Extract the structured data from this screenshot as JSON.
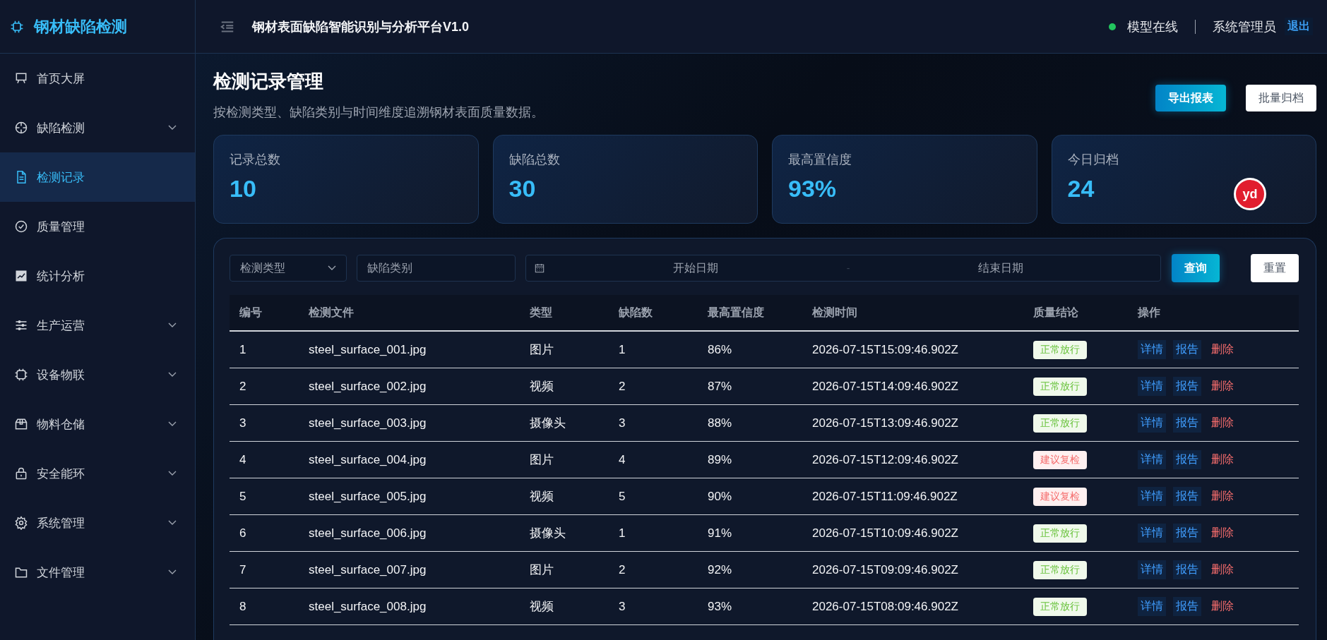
{
  "brand": {
    "name": "钢材缺陷检测"
  },
  "sidebar": {
    "items": [
      {
        "label": "首页大屏",
        "expandable": false,
        "selected": false
      },
      {
        "label": "缺陷检测",
        "expandable": true,
        "selected": false
      },
      {
        "label": "检测记录",
        "expandable": false,
        "selected": true
      },
      {
        "label": "质量管理",
        "expandable": false,
        "selected": false
      },
      {
        "label": "统计分析",
        "expandable": false,
        "selected": false
      },
      {
        "label": "生产运营",
        "expandable": true,
        "selected": false
      },
      {
        "label": "设备物联",
        "expandable": true,
        "selected": false
      },
      {
        "label": "物料仓储",
        "expandable": true,
        "selected": false
      },
      {
        "label": "安全能环",
        "expandable": true,
        "selected": false
      },
      {
        "label": "系统管理",
        "expandable": true,
        "selected": false
      },
      {
        "label": "文件管理",
        "expandable": true,
        "selected": false
      }
    ]
  },
  "header": {
    "title": "钢材表面缺陷智能识别与分析平台V1.0",
    "status": "模型在线",
    "user": "系统管理员",
    "logout": "退出"
  },
  "page": {
    "title": "检测记录管理",
    "subtitle": "按检测类型、缺陷类别与时间维度追溯钢材表面质量数据。",
    "actions": [
      {
        "label": "导出报表",
        "kind": "primary"
      },
      {
        "label": "批量归档",
        "kind": "plain"
      }
    ]
  },
  "stats": [
    {
      "label": "记录总数",
      "value": "10"
    },
    {
      "label": "缺陷总数",
      "value": "30"
    },
    {
      "label": "最高置信度",
      "value": "93%"
    },
    {
      "label": "今日归档",
      "value": "24",
      "badge": "yd"
    }
  ],
  "filters": {
    "type": {
      "placeholder": "检测类型"
    },
    "category": {
      "placeholder": "缺陷类别"
    },
    "start": {
      "placeholder": "开始日期"
    },
    "separator": "-",
    "end": {
      "placeholder": "结束日期"
    },
    "buttons": [
      {
        "label": "查询",
        "kind": "primary"
      },
      {
        "label": "重置",
        "kind": "plain"
      }
    ]
  },
  "table": {
    "columns": [
      "编号",
      "检测文件",
      "类型",
      "缺陷数",
      "最高置信度",
      "检测时间",
      "质量结论",
      "操作"
    ],
    "rows": [
      {
        "id": "1",
        "file": "steel_surface_001.jpg",
        "type": "图片",
        "defects": "1",
        "confidence": "86%",
        "time": "2026-07-15T15:09:46.902Z",
        "verdict": {
          "label": "正常放行",
          "kind": "pass"
        },
        "actions": [
          "详情",
          "报告",
          "删除"
        ]
      },
      {
        "id": "2",
        "file": "steel_surface_002.jpg",
        "type": "视频",
        "defects": "2",
        "confidence": "87%",
        "time": "2026-07-15T14:09:46.902Z",
        "verdict": {
          "label": "正常放行",
          "kind": "pass"
        },
        "actions": [
          "详情",
          "报告",
          "删除"
        ]
      },
      {
        "id": "3",
        "file": "steel_surface_003.jpg",
        "type": "摄像头",
        "defects": "3",
        "confidence": "88%",
        "time": "2026-07-15T13:09:46.902Z",
        "verdict": {
          "label": "正常放行",
          "kind": "pass"
        },
        "actions": [
          "详情",
          "报告",
          "删除"
        ]
      },
      {
        "id": "4",
        "file": "steel_surface_004.jpg",
        "type": "图片",
        "defects": "4",
        "confidence": "89%",
        "time": "2026-07-15T12:09:46.902Z",
        "verdict": {
          "label": "建议复检",
          "kind": "review"
        },
        "actions": [
          "详情",
          "报告",
          "删除"
        ]
      },
      {
        "id": "5",
        "file": "steel_surface_005.jpg",
        "type": "视频",
        "defects": "5",
        "confidence": "90%",
        "time": "2026-07-15T11:09:46.902Z",
        "verdict": {
          "label": "建议复检",
          "kind": "review"
        },
        "actions": [
          "详情",
          "报告",
          "删除"
        ]
      },
      {
        "id": "6",
        "file": "steel_surface_006.jpg",
        "type": "摄像头",
        "defects": "1",
        "confidence": "91%",
        "time": "2026-07-15T10:09:46.902Z",
        "verdict": {
          "label": "正常放行",
          "kind": "pass"
        },
        "actions": [
          "详情",
          "报告",
          "删除"
        ]
      },
      {
        "id": "7",
        "file": "steel_surface_007.jpg",
        "type": "图片",
        "defects": "2",
        "confidence": "92%",
        "time": "2026-07-15T09:09:46.902Z",
        "verdict": {
          "label": "正常放行",
          "kind": "pass"
        },
        "actions": [
          "详情",
          "报告",
          "删除"
        ]
      },
      {
        "id": "8",
        "file": "steel_surface_008.jpg",
        "type": "视频",
        "defects": "3",
        "confidence": "93%",
        "time": "2026-07-15T08:09:46.902Z",
        "verdict": {
          "label": "正常放行",
          "kind": "pass"
        },
        "actions": [
          "详情",
          "报告",
          "删除"
        ]
      }
    ]
  }
}
